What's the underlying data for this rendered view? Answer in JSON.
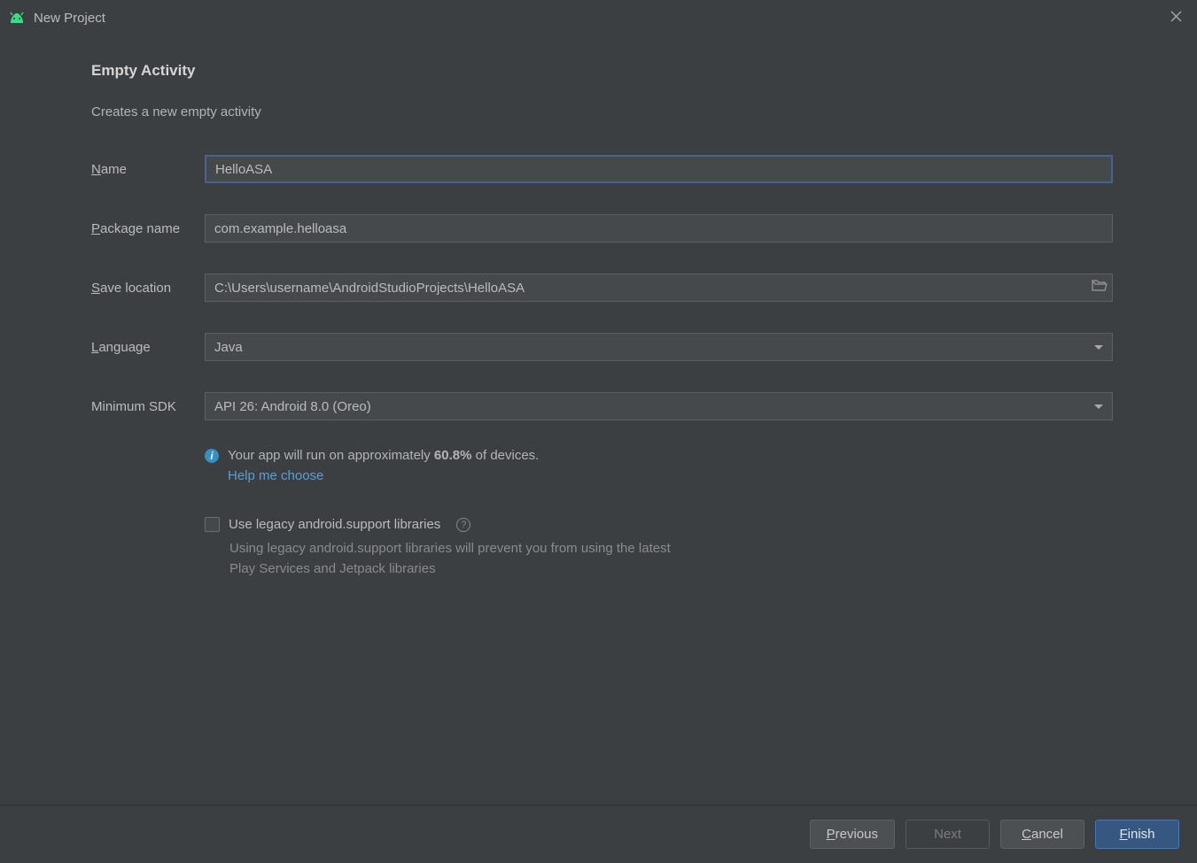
{
  "window": {
    "title": "New Project"
  },
  "heading": "Empty Activity",
  "subtitle": "Creates a new empty activity",
  "form": {
    "name": {
      "label_pre": "",
      "label_accel": "N",
      "label_post": "ame",
      "value": "HelloASA"
    },
    "package": {
      "label_pre": "",
      "label_accel": "P",
      "label_post": "ackage name",
      "value": "com.example.helloasa"
    },
    "save": {
      "label_pre": "",
      "label_accel": "S",
      "label_post": "ave location",
      "value": "C:\\Users\\username\\AndroidStudioProjects\\HelloASA"
    },
    "language": {
      "label_pre": "",
      "label_accel": "L",
      "label_post": "anguage",
      "value": "Java"
    },
    "minsdk": {
      "label": "Minimum SDK",
      "value": "API 26: Android 8.0 (Oreo)"
    }
  },
  "info": {
    "prefix": "Your app will run on approximately ",
    "percent": "60.8%",
    "suffix": " of devices.",
    "help_link": "Help me choose"
  },
  "legacy": {
    "label": "Use legacy android.support libraries",
    "hint": "Using legacy android.support libraries will prevent you from using the latest Play Services and Jetpack libraries"
  },
  "footer": {
    "previous": {
      "accel": "P",
      "rest": "revious"
    },
    "next": "Next",
    "cancel": {
      "accel": "C",
      "rest": "ancel"
    },
    "finish": {
      "accel": "F",
      "rest": "inish"
    }
  }
}
